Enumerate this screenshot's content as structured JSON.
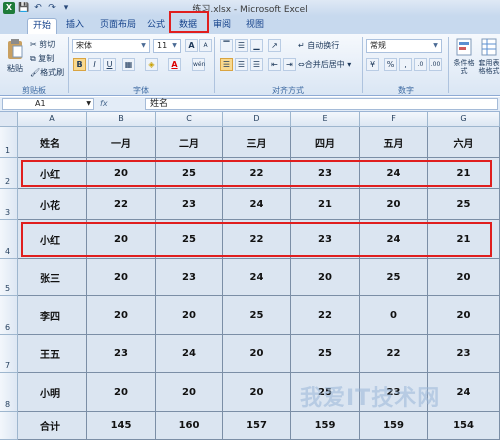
{
  "window": {
    "title": "练习.xlsx - Microsoft Excel",
    "app_letter": "X"
  },
  "quick_access": {
    "save": "💾",
    "undo": "↶",
    "redo": "↷",
    "more": "▾"
  },
  "tabs": [
    {
      "label": "开始",
      "active": true
    },
    {
      "label": "插入"
    },
    {
      "label": "页面布局"
    },
    {
      "label": "公式"
    },
    {
      "label": "数据",
      "highlighted": true
    },
    {
      "label": "审阅"
    },
    {
      "label": "视图"
    }
  ],
  "ribbon": {
    "clipboard": {
      "paste": "粘贴",
      "cut": "剪切",
      "copy": "复制",
      "format_painter": "格式刷",
      "label": "剪贴板"
    },
    "font": {
      "name": "宋体",
      "size": "11",
      "grow": "A",
      "shrink": "A",
      "bold": "B",
      "italic": "I",
      "underline": "U",
      "wen": "wén",
      "label": "字体"
    },
    "alignment": {
      "wrap": "自动换行",
      "merge": "合并后居中",
      "label": "对齐方式"
    },
    "number": {
      "format": "常规",
      "percent": "%",
      "comma": ",",
      "label": "数字"
    },
    "styles": {
      "conditional": "条件格式",
      "table": "套用表格格式"
    }
  },
  "formula_bar": {
    "name_box": "A1",
    "fx": "fx",
    "value": "姓名"
  },
  "columns": [
    "A",
    "B",
    "C",
    "D",
    "E",
    "F",
    "G"
  ],
  "rows": [
    "1",
    "2",
    "3",
    "4",
    "5",
    "6",
    "7",
    "8"
  ],
  "table": [
    [
      "姓名",
      "一月",
      "二月",
      "三月",
      "四月",
      "五月",
      "六月"
    ],
    [
      "小红",
      "20",
      "25",
      "22",
      "23",
      "24",
      "21"
    ],
    [
      "小花",
      "22",
      "23",
      "24",
      "21",
      "20",
      "25"
    ],
    [
      "小红",
      "20",
      "25",
      "22",
      "23",
      "24",
      "21"
    ],
    [
      "张三",
      "20",
      "23",
      "24",
      "20",
      "25",
      "20"
    ],
    [
      "李四",
      "20",
      "20",
      "25",
      "22",
      "0",
      "20"
    ],
    [
      "王五",
      "23",
      "24",
      "20",
      "25",
      "22",
      "23"
    ],
    [
      "小明",
      "20",
      "20",
      "20",
      "25",
      "23",
      "24"
    ],
    [
      "合计",
      "145",
      "160",
      "157",
      "159",
      "159",
      "154"
    ]
  ],
  "watermark": "我爱IT技术网",
  "colors": {
    "highlight_red": "#e01e1e",
    "cell_fill": "#dbe5f1"
  }
}
